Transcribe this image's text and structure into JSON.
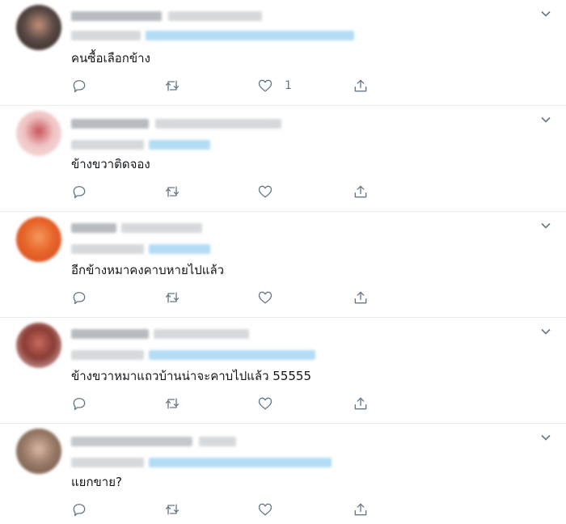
{
  "tweets": [
    {
      "text": "คนซื้อเลือกข้าง",
      "likes": "1",
      "avatar_colors": [
        "#5a4a45",
        "#c28f7a",
        "#2c2321"
      ]
    },
    {
      "text": "ข้างขวาติดจอง",
      "likes": "",
      "avatar_colors": [
        "#f0c4c4",
        "#c9545c",
        "#f7e6e6"
      ]
    },
    {
      "text": "อีกข้างหมาคงคาบหายไปแล้ว",
      "likes": "",
      "avatar_colors": [
        "#e8652b",
        "#f39a5d",
        "#d14a1c"
      ]
    },
    {
      "text": "ข้างขวาหมาแถวบ้านน่าจะคาบไปแล้ว 55555",
      "likes": "",
      "avatar_colors": [
        "#8a3b35",
        "#c86a5d",
        "#e5c2c0"
      ]
    },
    {
      "text": "แยกขาย?",
      "likes": "",
      "avatar_colors": [
        "#9a7a68",
        "#d8b9a3",
        "#6b5346"
      ]
    }
  ],
  "icons": {
    "reply": "reply-icon",
    "retweet": "retweet-icon",
    "like": "like-icon",
    "share": "share-icon",
    "more": "chevron-down-icon"
  },
  "colors": {
    "icon": "#657786",
    "divider": "#e6ecf0",
    "blur_gray": "#c8ccd0",
    "blur_blue": "#b3dcf5"
  }
}
